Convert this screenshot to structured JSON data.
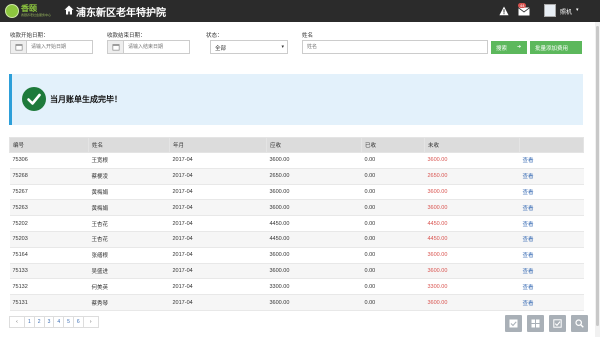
{
  "header": {
    "logo_text": "香颐",
    "logo_subtext": "香颐养老社会服务中心",
    "title": "浦东新区老年特护院",
    "mail_badge": "44",
    "user_name": "照机"
  },
  "filters": {
    "start_label": "收款开始日期：",
    "start_placeholder": "请输入开始日期",
    "end_label": "收款结束日期：",
    "end_placeholder": "请输入结束日期",
    "status_label": "状态：",
    "status_value": "全部",
    "name_label": "姓名",
    "name_placeholder": "姓名",
    "search_label": "搜索",
    "batch_label": "批量添加费用"
  },
  "alert": {
    "message": "当月账单生成完毕！"
  },
  "table": {
    "headers": [
      "编号",
      "姓名",
      "年月",
      "应收",
      "已收",
      "未收",
      ""
    ],
    "rows": [
      [
        "75306",
        "王宽根",
        "2017-04",
        "3600.00",
        "0.00",
        "3600.00",
        "查看"
      ],
      [
        "75268",
        "蔡梗凌",
        "2017-04",
        "2650.00",
        "0.00",
        "2650.00",
        "查看"
      ],
      [
        "75267",
        "黄梅娟",
        "2017-04",
        "3600.00",
        "0.00",
        "3600.00",
        "查看"
      ],
      [
        "75263",
        "黄梅娟",
        "2017-04",
        "3600.00",
        "0.00",
        "3600.00",
        "查看"
      ],
      [
        "75202",
        "王杏花",
        "2017-04",
        "4450.00",
        "0.00",
        "4450.00",
        "查看"
      ],
      [
        "75203",
        "王杏花",
        "2017-04",
        "4450.00",
        "0.00",
        "4450.00",
        "查看"
      ],
      [
        "75164",
        "张缮根",
        "2017-04",
        "3600.00",
        "0.00",
        "3600.00",
        "查看"
      ],
      [
        "75133",
        "吴盛进",
        "2017-04",
        "3600.00",
        "0.00",
        "3600.00",
        "查看"
      ],
      [
        "75132",
        "何美英",
        "2017-04",
        "3300.00",
        "0.00",
        "3300.00",
        "查看"
      ],
      [
        "75131",
        "蔡秀琴",
        "2017-04",
        "3600.00",
        "0.00",
        "3600.00",
        "查看"
      ]
    ]
  },
  "pagination": {
    "prev": "‹",
    "pages": [
      "1",
      "2",
      "3",
      "4",
      "5",
      "6"
    ],
    "next": "›"
  },
  "colors": {
    "topbar": "#2b2b2b",
    "accent_green": "#5cb85c",
    "alert_bg": "#e3f1fb",
    "owed_red": "#d9534f",
    "link_blue": "#3a6db5"
  },
  "tools": [
    "check-icon",
    "grid-icon",
    "check-square-icon",
    "search-icon"
  ]
}
